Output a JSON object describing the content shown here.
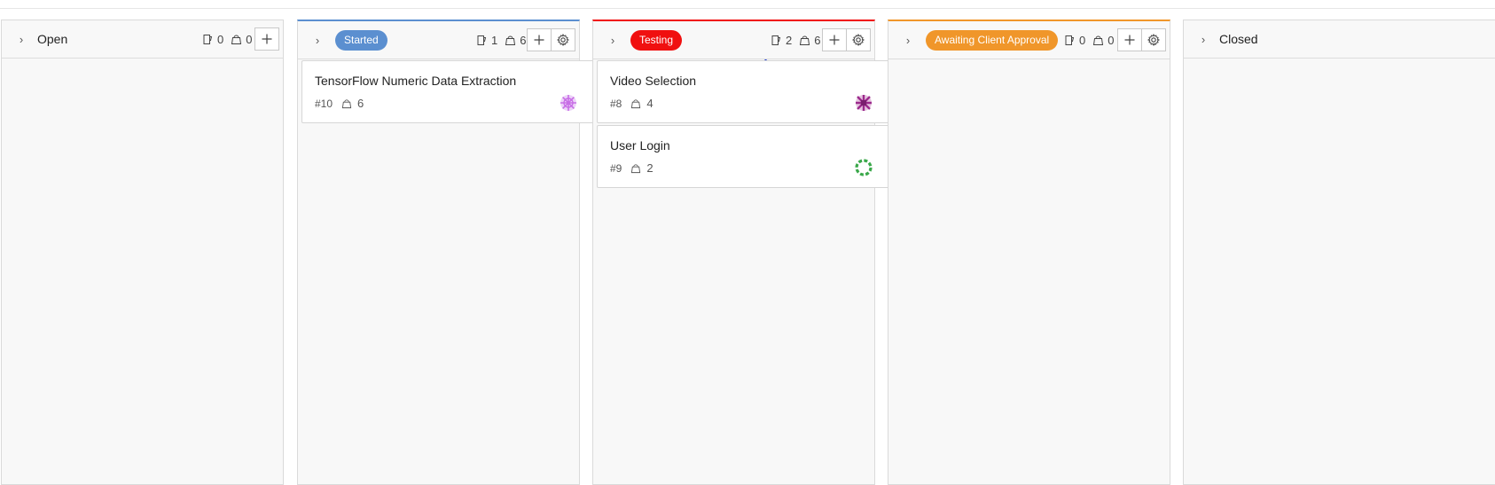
{
  "columns": [
    {
      "title": "Open",
      "issues": "0",
      "points": "0"
    },
    {
      "title": "Started",
      "issues": "1",
      "points": "6",
      "color": "#5b8fd0",
      "cards": [
        {
          "title": "TensorFlow Numeric Data Extraction",
          "number": "#10",
          "estimate": "6",
          "avatar_color": "#c86ee6"
        }
      ]
    },
    {
      "title": "Testing",
      "issues": "2",
      "points": "6",
      "color": "#f01010",
      "cards": [
        {
          "title": "Video Selection",
          "number": "#8",
          "estimate": "4",
          "avatar_color": "#9b2a8c"
        },
        {
          "title": "User Login",
          "number": "#9",
          "estimate": "2",
          "avatar_color": "#3aa84a"
        }
      ]
    },
    {
      "title": "Awaiting Client Approval",
      "issues": "0",
      "points": "0",
      "color": "#f0962a"
    },
    {
      "title": "Closed"
    }
  ],
  "icons": {
    "issue_count": "mug-icon",
    "story_points": "weight-icon",
    "add": "plus-icon",
    "settings": "gear-icon",
    "expand": "chevron-right-icon"
  }
}
